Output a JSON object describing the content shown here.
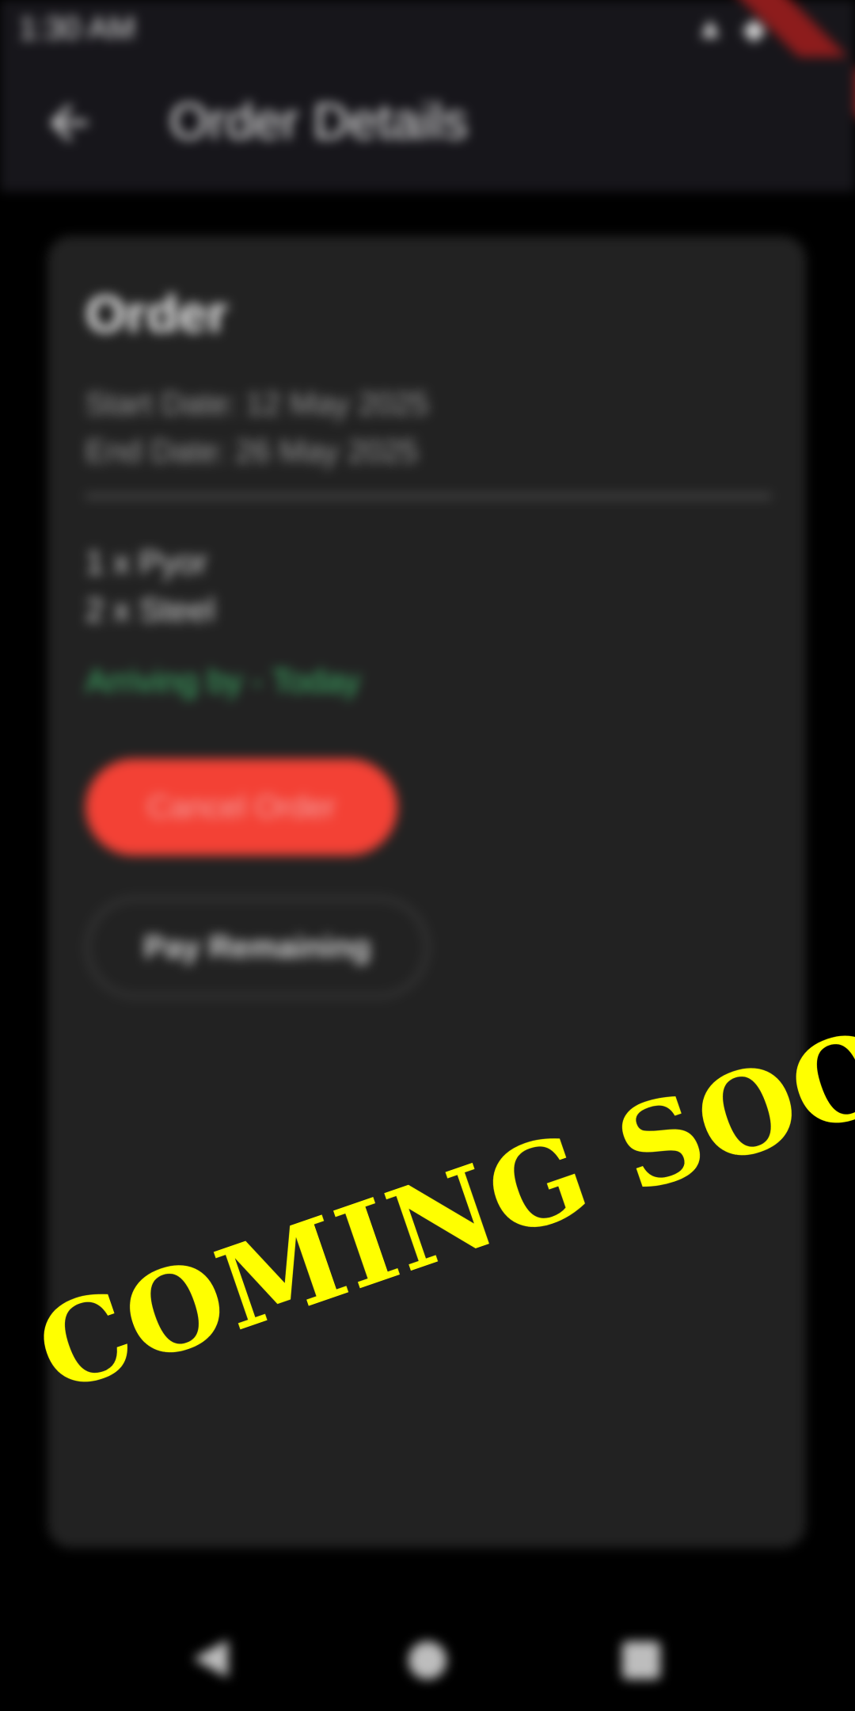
{
  "status_bar": {
    "time": "1:30 AM",
    "icons": [
      "signal-icon",
      "wifi-icon",
      "battery-icon"
    ]
  },
  "app_bar": {
    "back_icon": "arrow-back-icon",
    "title": "Order Details"
  },
  "card": {
    "title": "Order",
    "start_date": "Start Date: 12 May 2025",
    "end_date": "End Date: 26 May 2025",
    "items": [
      "1 x Pyor",
      "2 x Steel"
    ],
    "arriving": "Arriving by - Today",
    "cancel_label": "Cancel Order",
    "pay_label": "Pay Remaining"
  },
  "overlay": {
    "text": "COMING SOON"
  },
  "nav_bar": {
    "icons": [
      "nav-back-icon",
      "nav-home-icon",
      "nav-recents-icon"
    ]
  },
  "colors": {
    "background": "#000000",
    "surface": "#222222",
    "app_bar": "#17161b",
    "accent_red": "#f34135",
    "accent_green": "#3fb56a",
    "overlay_yellow": "#ffff00"
  }
}
